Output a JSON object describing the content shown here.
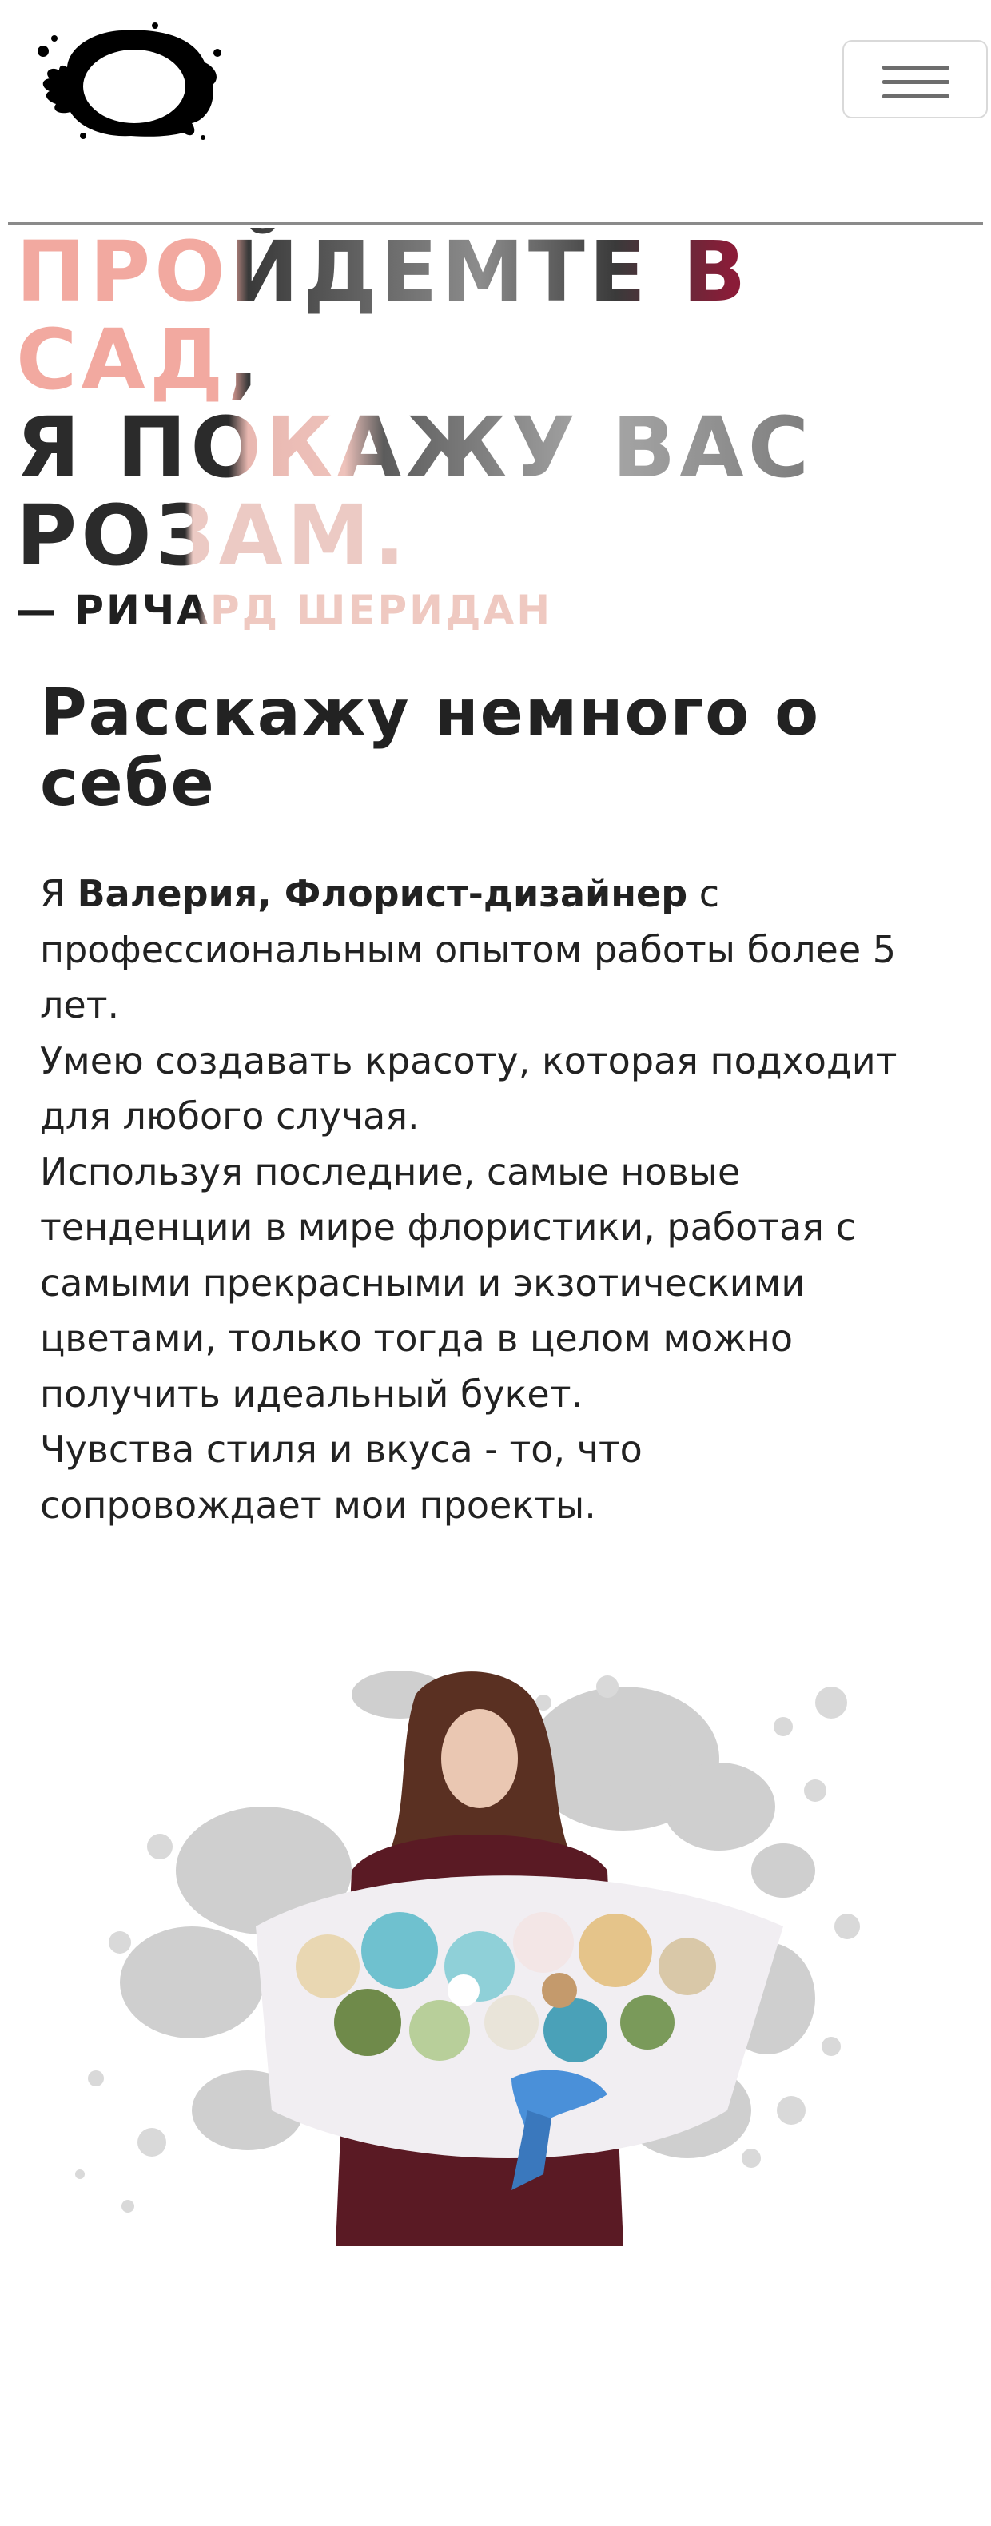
{
  "header": {
    "logo_icon": "ink-blot-logo-icon",
    "menu_icon": "hamburger-menu-icon"
  },
  "quote": {
    "line1": "ПРОЙДЕМТЕ В САД,",
    "line2": "Я ПОКАЖУ ВАС",
    "line3": "РОЗАМ.",
    "author": "— РИЧАРД ШЕРИДАН"
  },
  "about": {
    "title": "Расскажу немного о себе",
    "intro_prefix": "Я ",
    "name_role": "Валерия, Флорист-дизайнер",
    "intro_rest": " с профессиональным опытом работы более 5 лет.",
    "p2": "Умею создавать красоту, которая подходит для любого случая.",
    "p3": "Используя последние, самые новые тенденции в мире флористики, работая с самыми прекрасными и экзотическими цветами, только тогда в целом можно получить идеальный букет.",
    "p4": "Чувства стиля и вкуса - то, что сопровождает мои проекты."
  },
  "photo": {
    "icon": "florist-with-bouquet-illustration"
  },
  "colors": {
    "accent_pink": "#f2a9a0",
    "accent_wine": "#8a1c38",
    "text_dark": "#222222",
    "blot_gray": "#cfcfcf"
  }
}
